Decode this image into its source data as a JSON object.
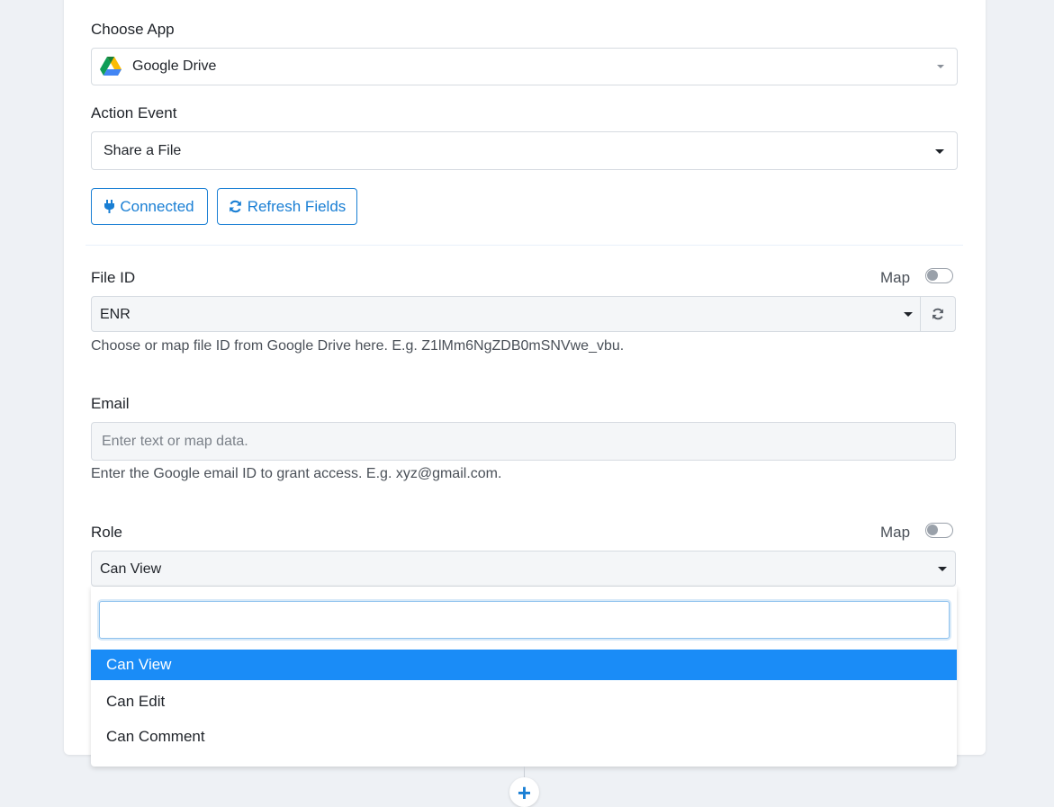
{
  "choose_app": {
    "label": "Choose App",
    "selected": "Google Drive",
    "icon": "google-drive-icon"
  },
  "action_event": {
    "label": "Action Event",
    "selected": "Share a File"
  },
  "buttons": {
    "connected_label": "Connected",
    "connected_icon": "plug-icon",
    "refresh_label": "Refresh Fields",
    "refresh_icon": "refresh-icon"
  },
  "file_id": {
    "label": "File ID",
    "map_label": "Map",
    "map_enabled": false,
    "value": "ENR",
    "help": "Choose or map file ID from Google Drive here. E.g. Z1lMm6NgZDB0mSNVwe_vbu."
  },
  "email": {
    "label": "Email",
    "placeholder": "Enter text or map data.",
    "help": "Enter the Google email ID to grant access. E.g. xyz@gmail.com."
  },
  "role": {
    "label": "Role",
    "map_label": "Map",
    "map_enabled": false,
    "selected": "Can View",
    "options": [
      "Can View",
      "Can Edit",
      "Can Comment"
    ]
  },
  "add_step_symbol": "+",
  "colors": {
    "accent": "#1a7fd4",
    "selected_option": "#1a8cf7",
    "background": "#eef1f5"
  }
}
